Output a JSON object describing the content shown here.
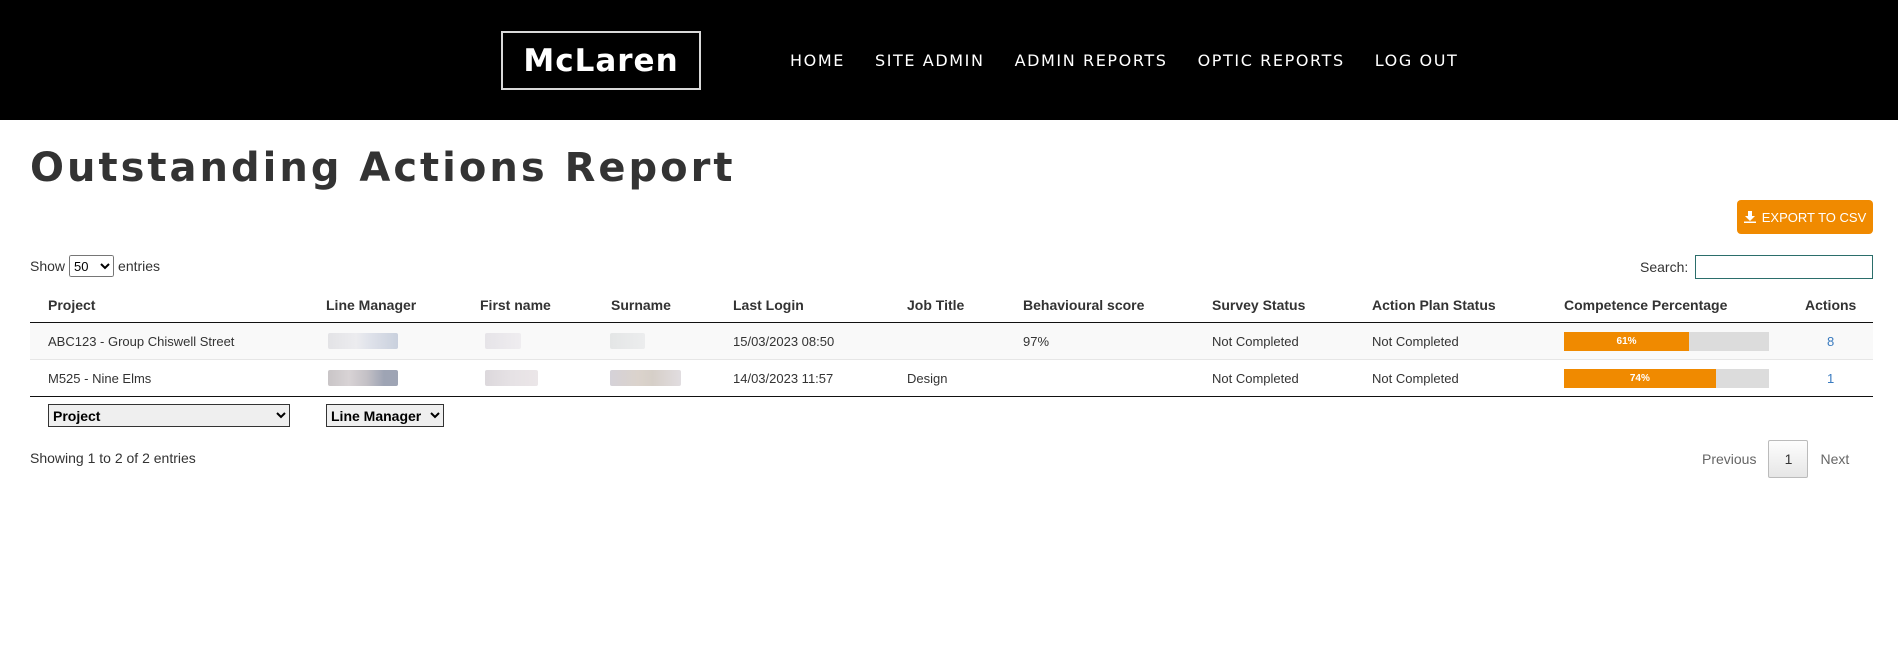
{
  "header": {
    "logo_text": "McLaren",
    "nav": [
      "HOME",
      "SITE ADMIN",
      "ADMIN REPORTS",
      "OPTIC REPORTS",
      "LOG OUT"
    ]
  },
  "page": {
    "title": "Outstanding Actions Report",
    "export_label": "EXPORT TO CSV"
  },
  "controls": {
    "show_label": "Show",
    "entries_value": "50",
    "entries_label": "entries",
    "search_label": "Search:",
    "search_value": ""
  },
  "table": {
    "columns": [
      "Project",
      "Line Manager",
      "First name",
      "Surname",
      "Last Login",
      "Job Title",
      "Behavioural score",
      "Survey Status",
      "Action Plan Status",
      "Competence Percentage",
      "Actions"
    ],
    "rows": [
      {
        "project": "ABC123 - Group Chiswell Street",
        "last_login": "15/03/2023 08:50",
        "job_title": "",
        "behavioural_score": "97%",
        "survey_status": "Not Completed",
        "action_plan_status": "Not Completed",
        "competence_label": "61%",
        "competence_percent": 61,
        "actions": "8"
      },
      {
        "project": "M525 - Nine Elms",
        "last_login": "14/03/2023 11:57",
        "job_title": "Design",
        "behavioural_score": "",
        "survey_status": "Not Completed",
        "action_plan_status": "Not Completed",
        "competence_label": "74%",
        "competence_percent": 74,
        "actions": "1"
      }
    ]
  },
  "filters": {
    "project_value": "Project",
    "line_manager_value": "Line Manager"
  },
  "footer": {
    "info": "Showing 1 to 2 of 2 entries",
    "previous": "Previous",
    "current_page": "1",
    "next": "Next"
  },
  "colors": {
    "accent": "#f08a00",
    "header_bg": "#000000",
    "link": "#3a7bbf"
  }
}
